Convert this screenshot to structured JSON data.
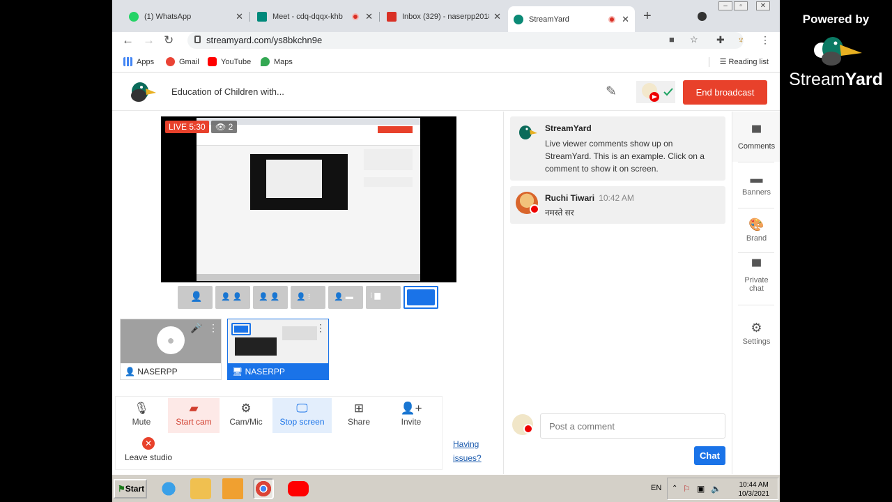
{
  "browser": {
    "tabs": [
      {
        "label": "(1) WhatsApp",
        "color": "#25d366"
      },
      {
        "label": "Meet - cdq-dqqx-khb",
        "color": "#00897b"
      },
      {
        "label": "Inbox (329) - naserpp2018@",
        "color": "#d93025"
      },
      {
        "label": "StreamYard",
        "color": "#0b8a76"
      }
    ],
    "url": "streamyard.com/ys8bkchn9e",
    "bookmarks": [
      {
        "label": "Apps",
        "color": "#4285f4"
      },
      {
        "label": "Gmail",
        "color": "#ea4335"
      },
      {
        "label": "YouTube",
        "color": "#ff0000"
      },
      {
        "label": "Maps",
        "color": "#34a853"
      }
    ],
    "reading_list": "Reading list"
  },
  "header": {
    "title": "Education of Children with...",
    "end_broadcast": "End broadcast"
  },
  "stage": {
    "live_label": "LIVE 5:30",
    "viewers": "2"
  },
  "thumbnails": [
    {
      "name": "NASERPP",
      "type": "camera"
    },
    {
      "name": "NASERPP",
      "type": "screen"
    }
  ],
  "controls": {
    "mute": "Mute",
    "start_cam": "Start cam",
    "cam_mic": "Cam/Mic",
    "stop_screen": "Stop screen",
    "share": "Share",
    "invite": "Invite",
    "leave": "Leave studio",
    "issues_1": "Having",
    "issues_2": "issues?"
  },
  "comments": [
    {
      "author": "StreamYard",
      "time": "",
      "text": "Live viewer comments show up on StreamYard. This is an example. Click on a comment to show it on screen."
    },
    {
      "author": "Ruchi Tiwari",
      "time": "10:42 AM",
      "text": "नमस्ते सर"
    }
  ],
  "post": {
    "placeholder": "Post a comment",
    "chat": "Chat"
  },
  "rail": {
    "comments": "Comments",
    "banners": "Banners",
    "brand": "Brand",
    "private_chat_1": "Private",
    "private_chat_2": "chat",
    "settings": "Settings"
  },
  "overlay": {
    "powered_by": "Powered by",
    "brand_a": "Stream",
    "brand_b": "Yard"
  },
  "taskbar": {
    "start": "Start",
    "lang": "EN",
    "time": "10:44 AM",
    "date": "10/3/2021"
  },
  "colors": {
    "accent_red": "#e8412b",
    "accent_blue": "#1a73e8"
  }
}
